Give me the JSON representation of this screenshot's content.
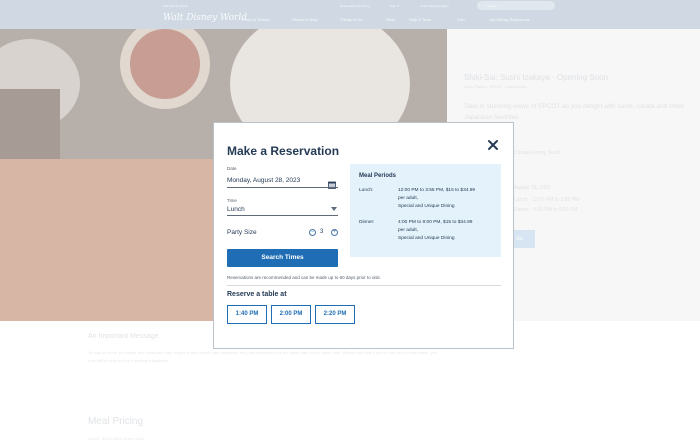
{
  "topbar": {
    "small_left": "Walt Disney World",
    "small_links": [
      "Reservations & Dining",
      "Sign In",
      "United States English"
    ],
    "logo": "Walt Disney World",
    "nav": [
      "Parks & Tickets",
      "Places to Stay",
      "Things to Do",
      "Shop",
      "Help & Tools",
      "Cart",
      "My Disney Experience"
    ],
    "search_placeholder": "Search"
  },
  "right_panel": {
    "title": "Shiki-Sai: Sushi Izakaya - Opening Soon",
    "subtitle": "Japan Pavilion · EPCOT · Casual Dining",
    "description": "Take in stunning views of EPCOT as you delight with sushi, robata and other Japanese favorites",
    "lines": [
      "Casual Dining, Sushi",
      "August 28, 2023",
      "Lunch · 12:00 PM to 3:55 PM",
      "Dinner · 4:00 PM to 9:00 PM"
    ],
    "button": "Go"
  },
  "lower": {
    "message_title": "An Important Message",
    "message_body": "To help us serve you better, this restaurant may require a valid theme park admission and park reservation for the same park on the same date. Please note that if you do not have a reservation, you may still be able to dine if seating is available.",
    "pricing_title": "Meal Pricing",
    "pricing_row": "Lunch · $15 to $34.99 per adult"
  },
  "modal": {
    "title": "Make a Reservation",
    "date_label": "Date",
    "date_value": "Monday, August 28, 2023",
    "time_label": "Time",
    "time_value": "Lunch",
    "party_label": "Party Size",
    "party_value": "3",
    "minus_symbol": "−",
    "plus_symbol": "+",
    "search_button": "Search Times",
    "note": "Reservations are recommended and can be made up to 60 days prior to visit.",
    "reserve_title": "Reserve a table at",
    "times": [
      "1:40 PM",
      "2:00 PM",
      "2:20 PM"
    ],
    "meal_periods": {
      "title": "Meal Periods",
      "periods": [
        {
          "label": "Lunch:",
          "lines": [
            "12:00 PM to 3:55 PM, $15 to $34.99",
            "per adult,",
            "Special and Unique Dining"
          ]
        },
        {
          "label": "Dinner:",
          "lines": [
            "4:00 PM to 9:00 PM, $15 to $34.99",
            "per adult,",
            "Special and Unique Dining"
          ]
        }
      ]
    }
  },
  "colors": {
    "primary": "#1f6db5",
    "heading": "#253b56",
    "meal_box_bg": "#e3f2fb"
  },
  "icons": [
    "close-icon",
    "calendar-icon",
    "chevron-down-icon",
    "minus-icon",
    "plus-icon",
    "search-icon",
    "cart-icon"
  ]
}
